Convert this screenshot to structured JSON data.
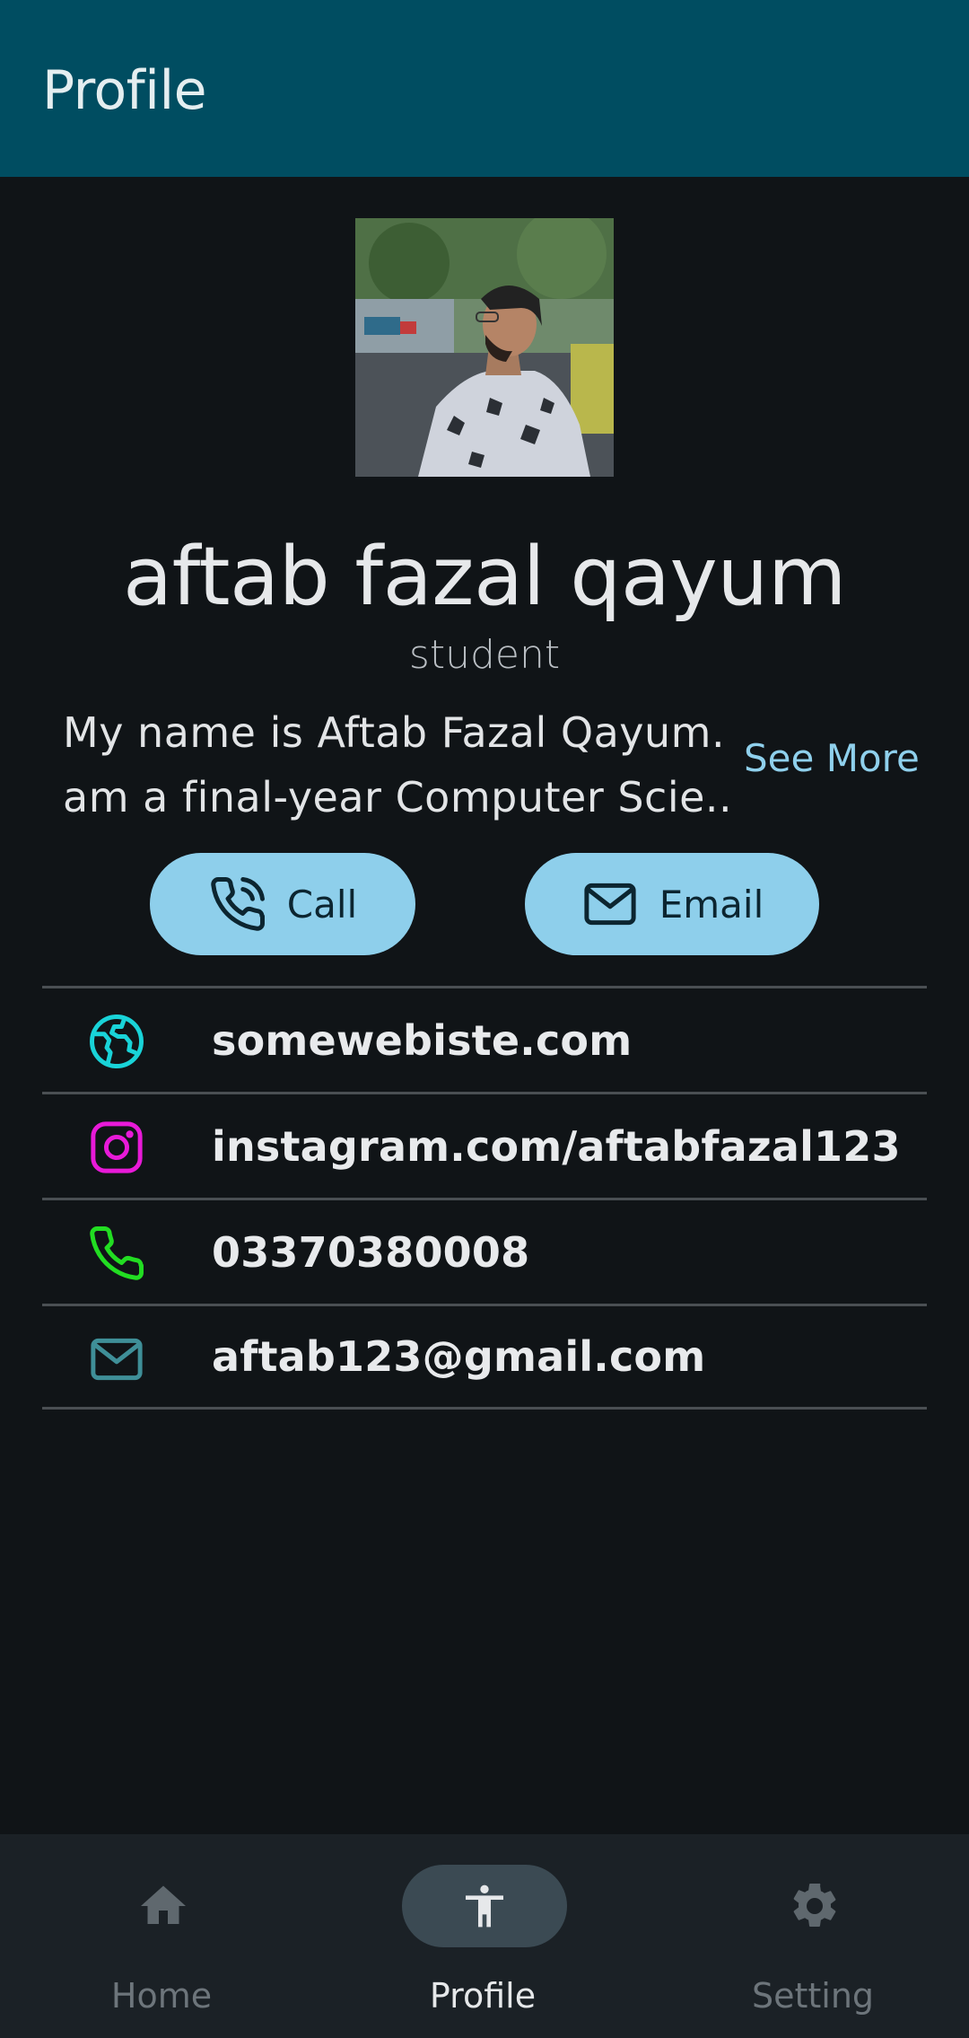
{
  "appbar": {
    "title": "Profile"
  },
  "profile": {
    "name": "aftab fazal qayum",
    "role": "student",
    "bio_line1": "My name is Aftab Fazal Qayum. I",
    "bio_line2": "am a final-year Computer Scie...",
    "see_more": "See More"
  },
  "actions": {
    "call_label": "Call",
    "email_label": "Email"
  },
  "contacts": [
    {
      "icon": "globe-icon",
      "text": "somewebiste.com",
      "color": "#19d3d8"
    },
    {
      "icon": "instagram-icon",
      "text": "instagram.com/aftabfazal123",
      "color": "#e81ad8"
    },
    {
      "icon": "phone-icon",
      "text": "03370380008",
      "color": "#22dd22"
    },
    {
      "icon": "mail-icon",
      "text": "aftab123@gmail.com",
      "color": "#3f8f98"
    }
  ],
  "nav": {
    "items": [
      {
        "label": "Home",
        "icon": "home-icon"
      },
      {
        "label": "Profile",
        "icon": "accessibility-icon",
        "active": true
      },
      {
        "label": "Setting",
        "icon": "gear-icon"
      }
    ]
  },
  "colors": {
    "appbar": "#004d61",
    "background": "#101417",
    "button": "#8ecfeb",
    "accent_link": "#8fd0ec",
    "navbar": "#1b2126"
  }
}
